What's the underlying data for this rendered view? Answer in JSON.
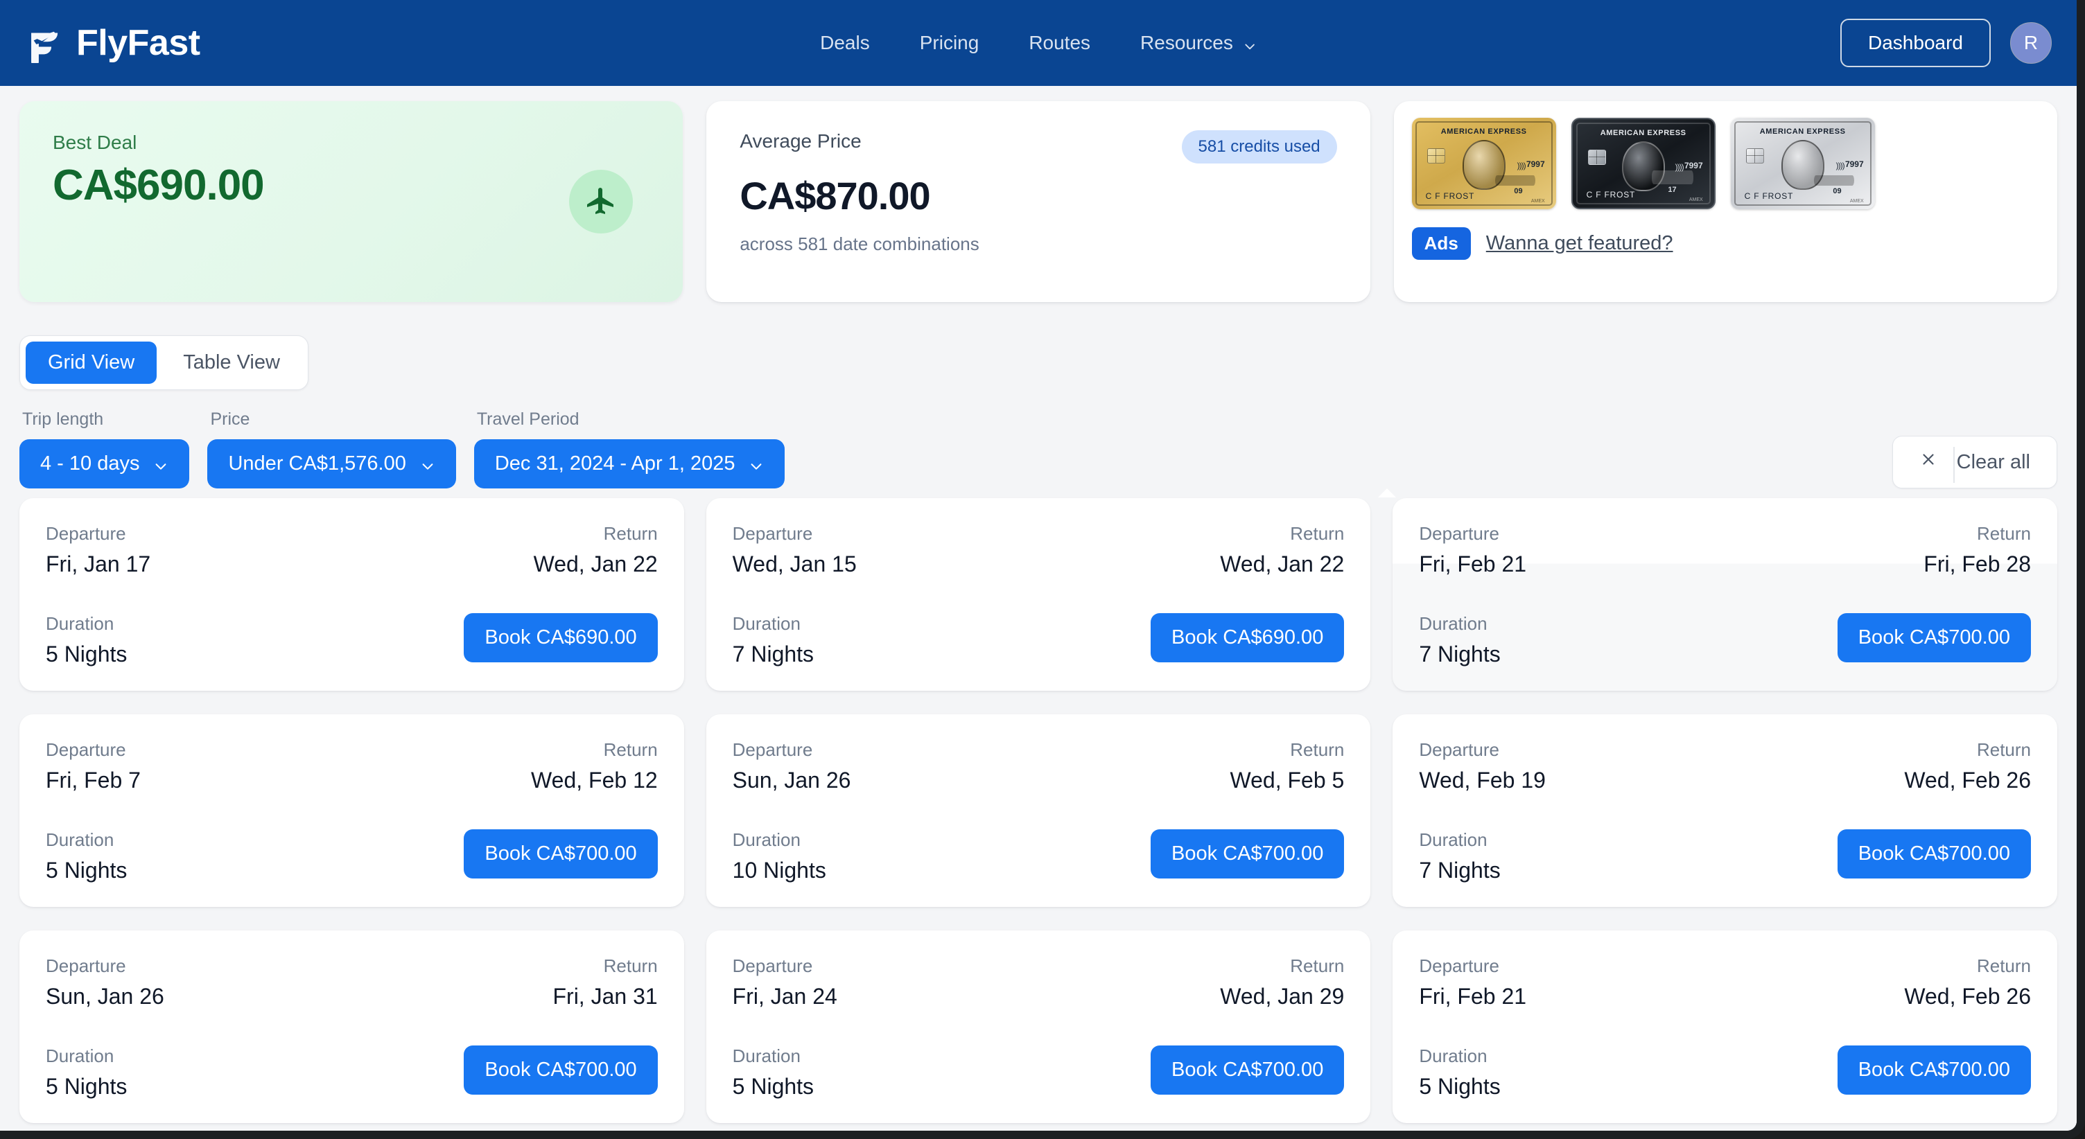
{
  "nav": {
    "brand": "FlyFast",
    "links": [
      {
        "label": "Deals",
        "caret": false
      },
      {
        "label": "Pricing",
        "caret": false
      },
      {
        "label": "Routes",
        "caret": false
      },
      {
        "label": "Resources",
        "caret": true
      }
    ],
    "dashboard_label": "Dashboard",
    "avatar_initial": "R"
  },
  "summary": {
    "best_deal": {
      "label": "Best Deal",
      "value": "CA$690.00",
      "icon": "airplane-icon"
    },
    "average": {
      "label": "Average Price",
      "value": "CA$870.00",
      "badge": "581 credits used",
      "sub": "across 581 date combinations"
    },
    "ad": {
      "ads_badge": "Ads",
      "link": "Wanna get featured?",
      "cards": [
        {
          "variant": "gold",
          "brand": "AMERICAN EXPRESS",
          "name": "C F FROST",
          "number": "7997",
          "tier": "09",
          "mark": "AMEX"
        },
        {
          "variant": "black",
          "brand": "AMERICAN EXPRESS",
          "name": "C F FROST",
          "number": "7997",
          "tier": "17",
          "mark": "AMEX"
        },
        {
          "variant": "plat",
          "brand": "AMERICAN EXPRESS",
          "name": "C F FROST",
          "number": "7997",
          "tier": "09",
          "mark": "AMEX"
        }
      ]
    }
  },
  "view_toggle": {
    "options": [
      {
        "label": "Grid View",
        "active": true
      },
      {
        "label": "Table View",
        "active": false
      }
    ]
  },
  "filters": {
    "items": [
      {
        "label": "Trip length",
        "value": "4 - 10 days"
      },
      {
        "label": "Price",
        "value": "Under CA$1,576.00"
      },
      {
        "label": "Travel Period",
        "value": "Dec 31, 2024 - Apr 1, 2025"
      }
    ],
    "clear_all": "Clear all"
  },
  "deal_captions": {
    "departure": "Departure",
    "return": "Return",
    "duration": "Duration"
  },
  "deals": [
    {
      "departure": "Fri, Jan 17",
      "return": "Wed, Jan 22",
      "duration": "5 Nights",
      "book": "Book CA$690.00",
      "hovered": false
    },
    {
      "departure": "Wed, Jan 15",
      "return": "Wed, Jan 22",
      "duration": "7 Nights",
      "book": "Book CA$690.00",
      "hovered": false
    },
    {
      "departure": "Fri, Feb 21",
      "return": "Fri, Feb 28",
      "duration": "7 Nights",
      "book": "Book CA$700.00",
      "hovered": true
    },
    {
      "departure": "Fri, Feb 7",
      "return": "Wed, Feb 12",
      "duration": "5 Nights",
      "book": "Book CA$700.00",
      "hovered": false
    },
    {
      "departure": "Sun, Jan 26",
      "return": "Wed, Feb 5",
      "duration": "10 Nights",
      "book": "Book CA$700.00",
      "hovered": false
    },
    {
      "departure": "Wed, Feb 19",
      "return": "Wed, Feb 26",
      "duration": "7 Nights",
      "book": "Book CA$700.00",
      "hovered": false
    },
    {
      "departure": "Sun, Jan 26",
      "return": "Fri, Jan 31",
      "duration": "5 Nights",
      "book": "Book CA$700.00",
      "hovered": false
    },
    {
      "departure": "Fri, Jan 24",
      "return": "Wed, Jan 29",
      "duration": "5 Nights",
      "book": "Book CA$700.00",
      "hovered": false
    },
    {
      "departure": "Fri, Feb 21",
      "return": "Wed, Feb 26",
      "duration": "5 Nights",
      "book": "Book CA$700.00",
      "hovered": false
    }
  ],
  "colors": {
    "nav_blue": "#0a4592",
    "accent_blue": "#1877f2",
    "deal_green": "#12692f",
    "page_bg": "#f4f5f7"
  }
}
